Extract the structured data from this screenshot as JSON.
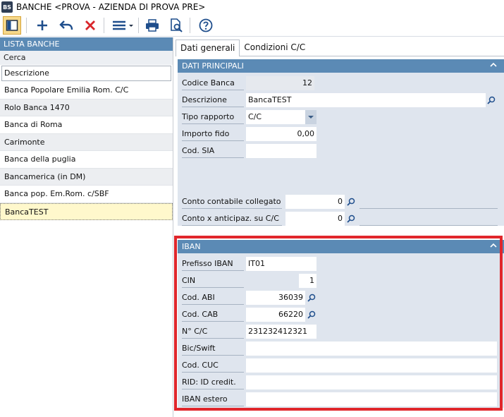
{
  "window": {
    "app_icon": "BS",
    "title": "BANCHE <PROVA - AZIENDA DI PROVA PRE>"
  },
  "toolbar": {
    "icons": [
      "panel-toggle-icon",
      "add-icon",
      "undo-icon",
      "delete-icon",
      "menu-icon",
      "print-icon",
      "print-preview-icon",
      "help-icon"
    ],
    "colors": {
      "primary": "#1f4e8c",
      "delete": "#d9262b",
      "active_bg": "#f6d88a"
    }
  },
  "left": {
    "header": "LISTA BANCHE",
    "search_label": "Cerca",
    "search_value": "Descrizione",
    "banks": [
      "Banca Popolare Emilia Rom. C/C",
      "Rolo Banca 1470",
      "Banca di Roma",
      "Carimonte",
      "Banca della puglia",
      "Bancamerica (in DM)",
      "Banca pop. Em.Rom. c/SBF",
      "BancaTEST"
    ],
    "selected": "BancaTEST"
  },
  "tabs": {
    "dati_generali": "Dati generali",
    "condizioni": "Condizioni C/C"
  },
  "dati_principali": {
    "title": "DATI PRINCIPALI",
    "codice_banca": {
      "label": "Codice Banca",
      "value": "12"
    },
    "descrizione": {
      "label": "Descrizione",
      "value": "BancaTEST"
    },
    "tipo_rapporto": {
      "label": "Tipo rapporto",
      "value": "C/C"
    },
    "importo_fido": {
      "label": "Importo fido",
      "value": "0,00"
    },
    "cod_sia": {
      "label": "Cod. SIA",
      "value": ""
    },
    "conto_contabile": {
      "label": "Conto contabile collegato",
      "value": "0"
    },
    "conto_anticipaz": {
      "label": "Conto x anticipaz. su C/C",
      "value": "0"
    }
  },
  "iban": {
    "title": "IBAN",
    "prefisso": {
      "label": "Prefisso IBAN",
      "value": "IT01"
    },
    "cin": {
      "label": "CIN",
      "value": "1"
    },
    "abi": {
      "label": "Cod. ABI",
      "value": "36039"
    },
    "cab": {
      "label": "Cod. CAB",
      "value": "66220"
    },
    "conto": {
      "label": "N° C/C",
      "value": "231232412321"
    },
    "bic": {
      "label": "Bic/Swift",
      "value": ""
    },
    "cuc": {
      "label": "Cod. CUC",
      "value": ""
    },
    "rid": {
      "label": "RID: ID credit.",
      "value": ""
    },
    "estero": {
      "label": "IBAN estero",
      "value": ""
    }
  },
  "highlight_color": "#e0262b"
}
